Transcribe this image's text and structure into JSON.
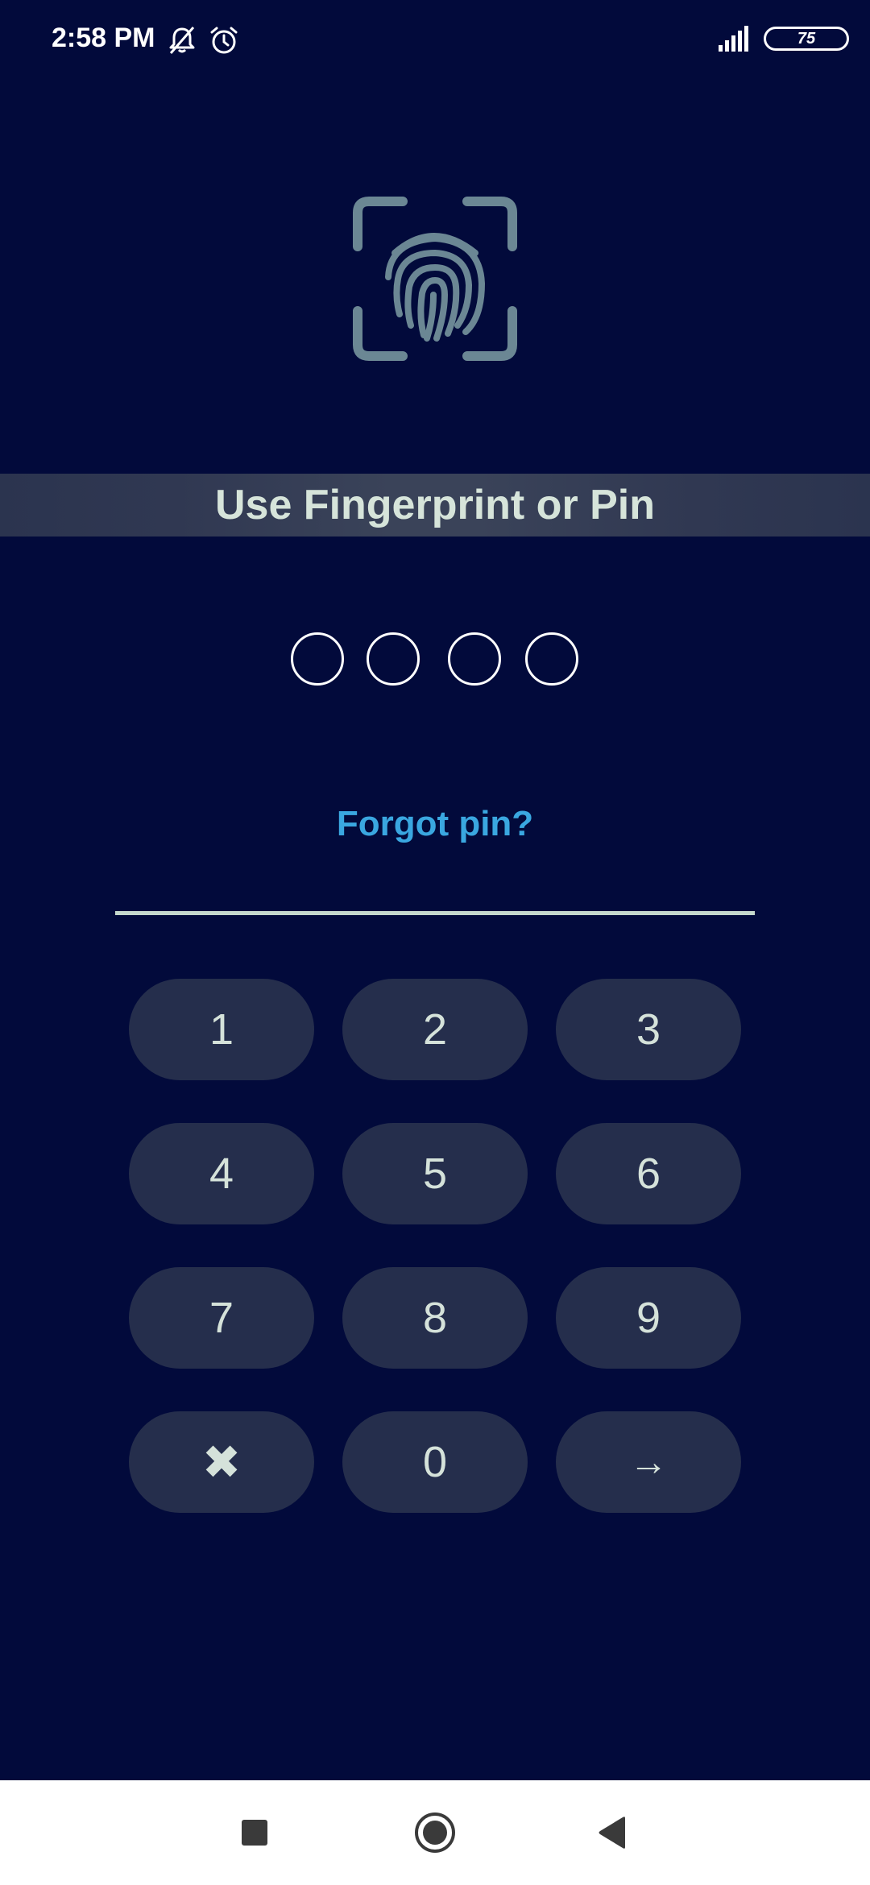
{
  "status_bar": {
    "time": "2:58 PM",
    "battery": "75",
    "icons": [
      "notifications-off-icon",
      "alarm-icon",
      "signal-icon",
      "battery-icon"
    ]
  },
  "lock_screen": {
    "icon": "fingerprint-icon",
    "title": "Use Fingerprint or Pin",
    "pin_length": 4,
    "forgot_pin": "Forgot pin?"
  },
  "keypad": {
    "keys": [
      "1",
      "2",
      "3",
      "4",
      "5",
      "6",
      "7",
      "8",
      "9",
      "✖",
      "0",
      "→"
    ],
    "clear_icon": "clear-icon",
    "submit_icon": "arrow-right-icon"
  },
  "nav_bar": {
    "icons": [
      "recents-icon",
      "home-icon",
      "back-icon"
    ]
  },
  "colors": {
    "background": "#020a3b",
    "key_background": "#252e4c",
    "key_text": "#d5e2da",
    "link": "#3aa7e0",
    "fingerprint": "#6b8794"
  }
}
